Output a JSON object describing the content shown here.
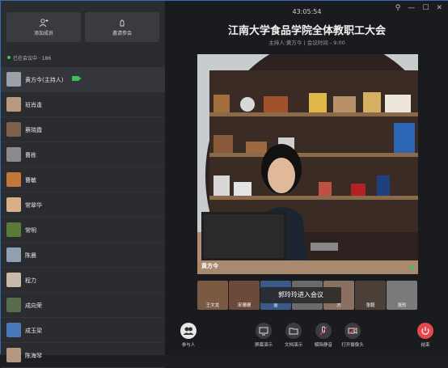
{
  "sidebar": {
    "add_member": "添加成员",
    "invite": "邀请参会",
    "in_meeting": "已在会议中 · 186",
    "participants": [
      {
        "name": "黄方今(主持人)",
        "camera_on": true
      },
      {
        "name": "班肖逢"
      },
      {
        "name": "蔡晓霞"
      },
      {
        "name": "曹栋"
      },
      {
        "name": "曹敏"
      },
      {
        "name": "常翠华"
      },
      {
        "name": "常明"
      },
      {
        "name": "陈晨"
      },
      {
        "name": "程力"
      },
      {
        "name": "成向荣"
      },
      {
        "name": "成玉梁"
      },
      {
        "name": "陈海琴"
      }
    ]
  },
  "header": {
    "clock": "43:05:54",
    "title": "江南大学食品学院全体教职工大会",
    "subtitle": "主持人:黄方今 | 会议时间 - 9:00"
  },
  "video": {
    "speaker_name": "黄方今"
  },
  "thumbnails": [
    "王文龙",
    "宋珊珊",
    "金",
    "",
    "方",
    "张毅",
    "张彤"
  ],
  "toast": "郭玲玲进入会议",
  "toolbar": {
    "participants": "参与人",
    "screen_share": "屏幕演示",
    "doc_share": "文档演示",
    "unmute": "解除静音",
    "camera": "打开摄像头",
    "end": "结束"
  },
  "colors": {
    "accent_green": "#3cc05a",
    "end_red": "#e5484d"
  }
}
